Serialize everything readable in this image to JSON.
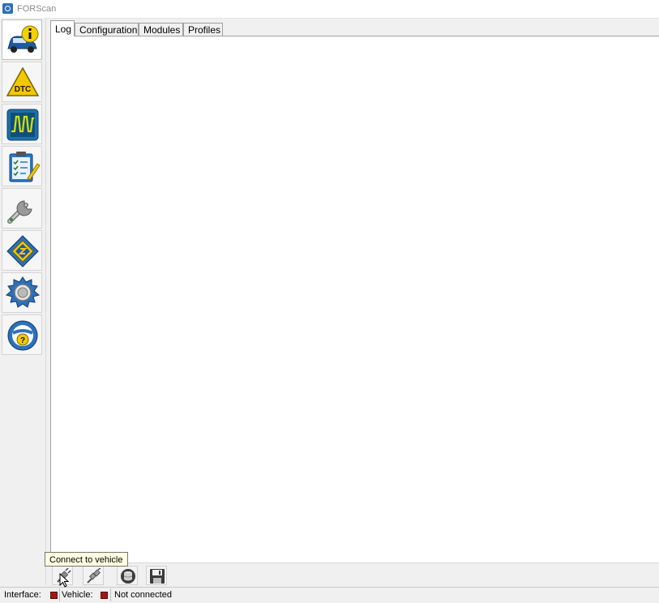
{
  "window": {
    "title": "FORScan"
  },
  "sidebar": {
    "items": [
      {
        "icon": "vehicle-info-icon",
        "active": true
      },
      {
        "icon": "dtc-icon",
        "label": "DTC"
      },
      {
        "icon": "oscilloscope-icon"
      },
      {
        "icon": "checklist-icon"
      },
      {
        "icon": "wrench-icon"
      },
      {
        "icon": "chip-icon"
      },
      {
        "icon": "settings-gear-icon"
      },
      {
        "icon": "help-icon",
        "label": "?"
      }
    ]
  },
  "tabs": [
    {
      "label": "Log",
      "active": true
    },
    {
      "label": "Configuration"
    },
    {
      "label": "Modules"
    },
    {
      "label": "Profiles"
    }
  ],
  "toolbar": {
    "buttons": [
      {
        "icon": "connect-icon"
      },
      {
        "icon": "disconnect-icon"
      },
      {
        "icon": "database-icon"
      },
      {
        "icon": "save-icon"
      }
    ],
    "tooltip": "Connect to vehicle"
  },
  "status": {
    "interface_label": "Interface:",
    "vehicle_label": "Vehicle:",
    "connection_text": "Not connected",
    "led_color": "#a01818"
  },
  "colors": {
    "accent": "#2f6fb5",
    "warning": "#f3d000"
  }
}
